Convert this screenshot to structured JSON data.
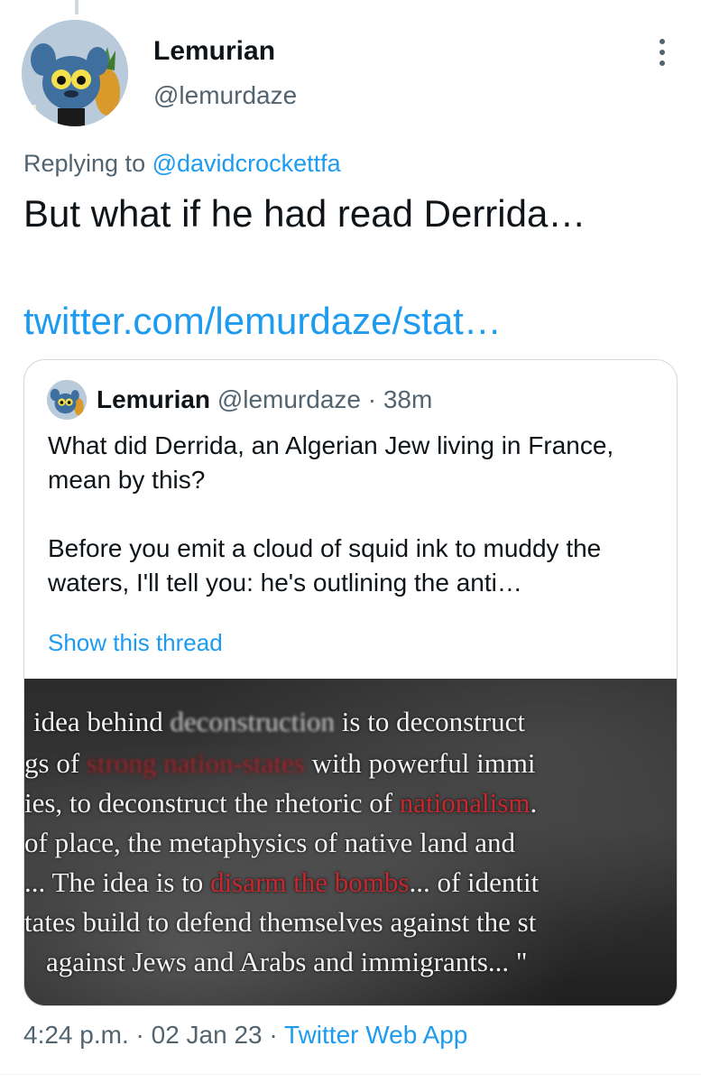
{
  "tweet": {
    "author": {
      "display_name": "Lemurian",
      "handle": "@lemurdaze",
      "avatar": "lemur-cartoon-avatar"
    },
    "replying_prefix": "Replying to",
    "replying_handle": "@davidcrockettfa",
    "text": "But what if he had read Derrida…",
    "link": "twitter.com/lemurdaze/stat…",
    "more_icon": "more-vertical-icon"
  },
  "quote": {
    "display_name": "Lemurian",
    "handle": "@lemurdaze",
    "separator": "·",
    "time_ago": "38m",
    "paragraph_1": "What did Derrida, an Algerian Jew living in France, mean by this?",
    "paragraph_2": "Before you emit a cloud of squid ink to muddy the waters, I'll tell you: he's outlining the anti…",
    "show_thread": "Show this thread",
    "image_text": {
      "l1_a": "idea behind",
      "l1_b": "deconstruction",
      "l1_c": "is to deconstruct",
      "l2_a": "gs of",
      "l2_b": "strong nation-states",
      "l2_c": "with powerful immi",
      "l3_a": "ies, to deconstruct the rhetoric of",
      "l3_b": "nationalism",
      "l3_c": ".",
      "l4": "of place, the metaphysics of native land and",
      "l5_a": "... The idea is to",
      "l5_b": "disarm the bombs",
      "l5_c": "... of identit",
      "l6": "tates build to defend themselves against the st",
      "l7": "against Jews and Arabs and immigrants... \""
    }
  },
  "footer": {
    "time": "4:24 p.m.",
    "sep1": "·",
    "date": "02 Jan 23",
    "sep2": "·",
    "app": "Twitter Web App"
  },
  "colors": {
    "accent": "#1d9bf0",
    "secondary_text": "#536471",
    "image_red": "#c7272f"
  }
}
